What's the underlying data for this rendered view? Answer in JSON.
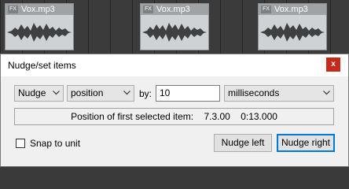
{
  "tracks": {
    "items": [
      {
        "name": "Vox.mp3",
        "fx": "FX"
      },
      {
        "name": "Vox.mp3",
        "fx": "FX"
      },
      {
        "name": "Vox.mp3",
        "fx": "FX"
      }
    ]
  },
  "dialog": {
    "title": "Nudge/set items",
    "close_label": "x",
    "action_select": "Nudge",
    "property_select": "position",
    "by_label": "by:",
    "amount_value": "10",
    "unit_select": "milliseconds",
    "info_label": "Position of first selected item:",
    "info_beats": "7.3.00",
    "info_time": "0:13.000",
    "snap_label": "Snap to unit",
    "nudge_left_label": "Nudge left",
    "nudge_right_label": "Nudge right"
  },
  "colors": {
    "close_button": "#c42b1c",
    "focus_border": "#0078d7"
  }
}
